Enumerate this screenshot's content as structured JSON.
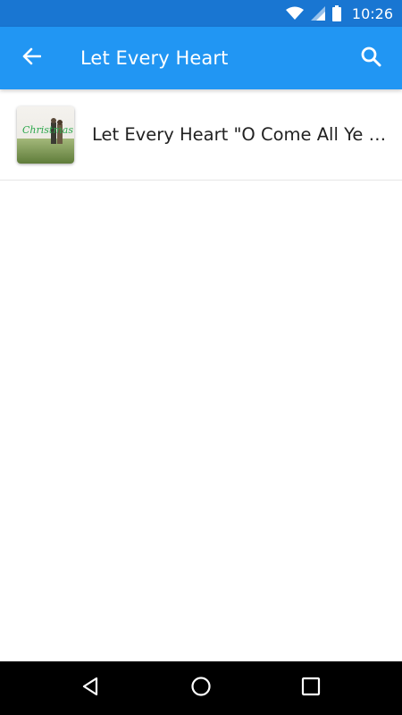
{
  "status_bar": {
    "time": "10:26",
    "icons": [
      "wifi-icon",
      "cell-signal-icon",
      "battery-icon"
    ]
  },
  "app_bar": {
    "title": "Let Every Heart",
    "back_icon": "arrow-left-icon",
    "search_icon": "search-icon",
    "color": "#2196f3",
    "status_color": "#1976d2"
  },
  "results": [
    {
      "title": "Let Every Heart \"O Come All Ye F...",
      "thumbnail": {
        "icon": "album-art-thumbnail",
        "caption": "Christmas"
      }
    }
  ],
  "nav_bar": {
    "icons": [
      "nav-back-icon",
      "nav-home-icon",
      "nav-recents-icon"
    ]
  }
}
